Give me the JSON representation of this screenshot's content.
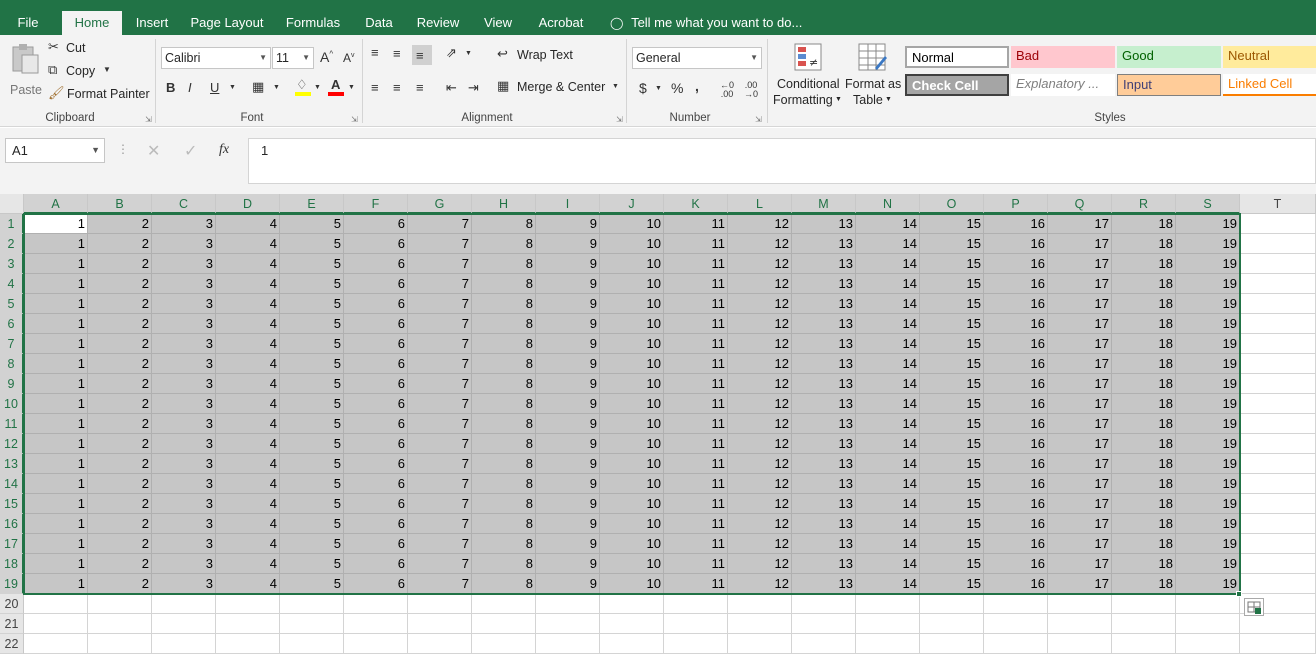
{
  "tabs": [
    {
      "label": "File",
      "active": false
    },
    {
      "label": "Home",
      "active": true
    },
    {
      "label": "Insert",
      "active": false
    },
    {
      "label": "Page Layout",
      "active": false
    },
    {
      "label": "Formulas",
      "active": false
    },
    {
      "label": "Data",
      "active": false
    },
    {
      "label": "Review",
      "active": false
    },
    {
      "label": "View",
      "active": false
    },
    {
      "label": "Acrobat",
      "active": false
    }
  ],
  "tell_me": "Tell me what you want to do...",
  "ribbon": {
    "clipboard": {
      "paste": "Paste",
      "cut": "Cut",
      "copy": "Copy",
      "format_painter": "Format Painter",
      "group": "Clipboard"
    },
    "font": {
      "name": "Calibri",
      "size": "11",
      "group": "Font",
      "bold": "B",
      "italic": "I",
      "underline": "U",
      "font_color": "#ff0000",
      "fill_color": "#ffff00"
    },
    "alignment": {
      "wrap_text": "Wrap Text",
      "merge_center": "Merge & Center",
      "group": "Alignment"
    },
    "number": {
      "format": "General",
      "currency": "$",
      "percent": "%",
      "comma": ",",
      "group": "Number"
    },
    "styles": {
      "conditional_1": "Conditional",
      "conditional_2": "Formatting",
      "format_table_1": "Format as",
      "format_table_2": "Table",
      "group": "Styles",
      "cells": [
        {
          "label": "Normal",
          "bg": "#ffffff",
          "fg": "#000000"
        },
        {
          "label": "Bad",
          "bg": "#ffc7ce",
          "fg": "#9c0006"
        },
        {
          "label": "Good",
          "bg": "#c6efce",
          "fg": "#006100"
        },
        {
          "label": "Neutral",
          "bg": "#ffeb9c",
          "fg": "#9c5700"
        },
        {
          "label": "Check Cell",
          "bg": "#a5a5a5",
          "fg": "#ffffff"
        },
        {
          "label": "Explanatory ...",
          "bg": "#ffffff",
          "fg": "#7f7f7f"
        },
        {
          "label": "Input",
          "bg": "#ffcc99",
          "fg": "#3f3f76"
        },
        {
          "label": "Linked Cell",
          "bg": "#ffffff",
          "fg": "#fa7d00"
        }
      ]
    }
  },
  "formula_bar": {
    "name_box": "A1",
    "fx": "fx",
    "value": "1"
  },
  "grid": {
    "columns": [
      "A",
      "B",
      "C",
      "D",
      "E",
      "F",
      "G",
      "H",
      "I",
      "J",
      "K",
      "L",
      "M",
      "N",
      "O",
      "P",
      "Q",
      "R",
      "S",
      "T"
    ],
    "rows": [
      "1",
      "2",
      "3",
      "4",
      "5",
      "6",
      "7",
      "8",
      "9",
      "10",
      "11",
      "12",
      "13",
      "14",
      "15",
      "16",
      "17",
      "18",
      "19",
      "20",
      "21",
      "22"
    ],
    "data_rows": 19,
    "row_values": [
      "1",
      "2",
      "3",
      "4",
      "5",
      "6",
      "7",
      "8",
      "9",
      "10",
      "11",
      "12",
      "13",
      "14",
      "15",
      "16",
      "17",
      "18",
      "19"
    ],
    "selection": "A1:S19",
    "accent": "#217346"
  }
}
